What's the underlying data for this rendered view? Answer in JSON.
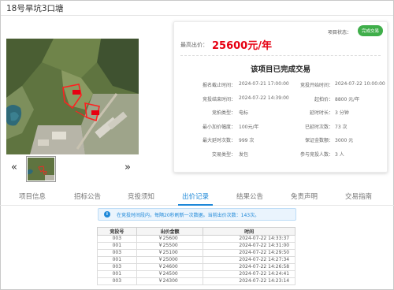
{
  "page_title": "18号旱坑3口塘",
  "info": {
    "status_label": "项目状态：",
    "status_badge": "完成交易",
    "price_label": "最高出价：",
    "price_value": "25600元/年",
    "completed_heading": "该项目已完成交易",
    "rows": [
      {
        "k1": "报名截止时间：",
        "v1": "2024-07-21 17:00:00",
        "k2": "竞投开始时间：",
        "v2": "2024-07-22 10:00:00"
      },
      {
        "k1": "竞投结束时间：",
        "v1": "2024-07-22 14:39:00",
        "k2": "起拍价：",
        "v2": "8800 元/年"
      },
      {
        "k1": "竞拍类型：",
        "v1": "电标",
        "k2": "延时时长：",
        "v2": "3 分钟"
      },
      {
        "k1": "最小加价幅度：",
        "v1": "100元/年",
        "k2": "已延时次数：",
        "v2": "73 次"
      },
      {
        "k1": "最大延时次数：",
        "v1": "999 次",
        "k2": "保证金数额：",
        "v2": "3000 元"
      },
      {
        "k1": "交易类型：",
        "v1": "发包",
        "k2": "参与竞投人数：",
        "v2": "3 人"
      }
    ]
  },
  "gallery": {
    "prev": "«",
    "next": "»"
  },
  "tabs": [
    {
      "label": "项目信息"
    },
    {
      "label": "招标公告"
    },
    {
      "label": "竞投须知"
    },
    {
      "label": "出价记录"
    },
    {
      "label": "结果公告"
    },
    {
      "label": "免责声明"
    },
    {
      "label": "交易指南"
    }
  ],
  "active_tab_index": 3,
  "notice": {
    "icon": "i",
    "text": "在竞投时间段内，每隔20秒刷新一次数据。当前出价次数：143次。"
  },
  "bid_table": {
    "headers": [
      "竞投号",
      "出价金额",
      "时间"
    ],
    "rows": [
      [
        "003",
        "￥25600",
        "2024-07-22 14:33:37"
      ],
      [
        "001",
        "￥25500",
        "2024-07-22 14:31:00"
      ],
      [
        "003",
        "￥25100",
        "2024-07-22 14:29:50"
      ],
      [
        "001",
        "￥25000",
        "2024-07-22 14:27:34"
      ],
      [
        "003",
        "￥24600",
        "2024-07-22 14:26:58"
      ],
      [
        "001",
        "￥24500",
        "2024-07-22 14:24:41"
      ],
      [
        "003",
        "￥24300",
        "2024-07-22 14:23:14"
      ]
    ]
  },
  "colors": {
    "accent": "#1e88d8",
    "price": "#e60012",
    "status_green": "#3fae4a"
  }
}
